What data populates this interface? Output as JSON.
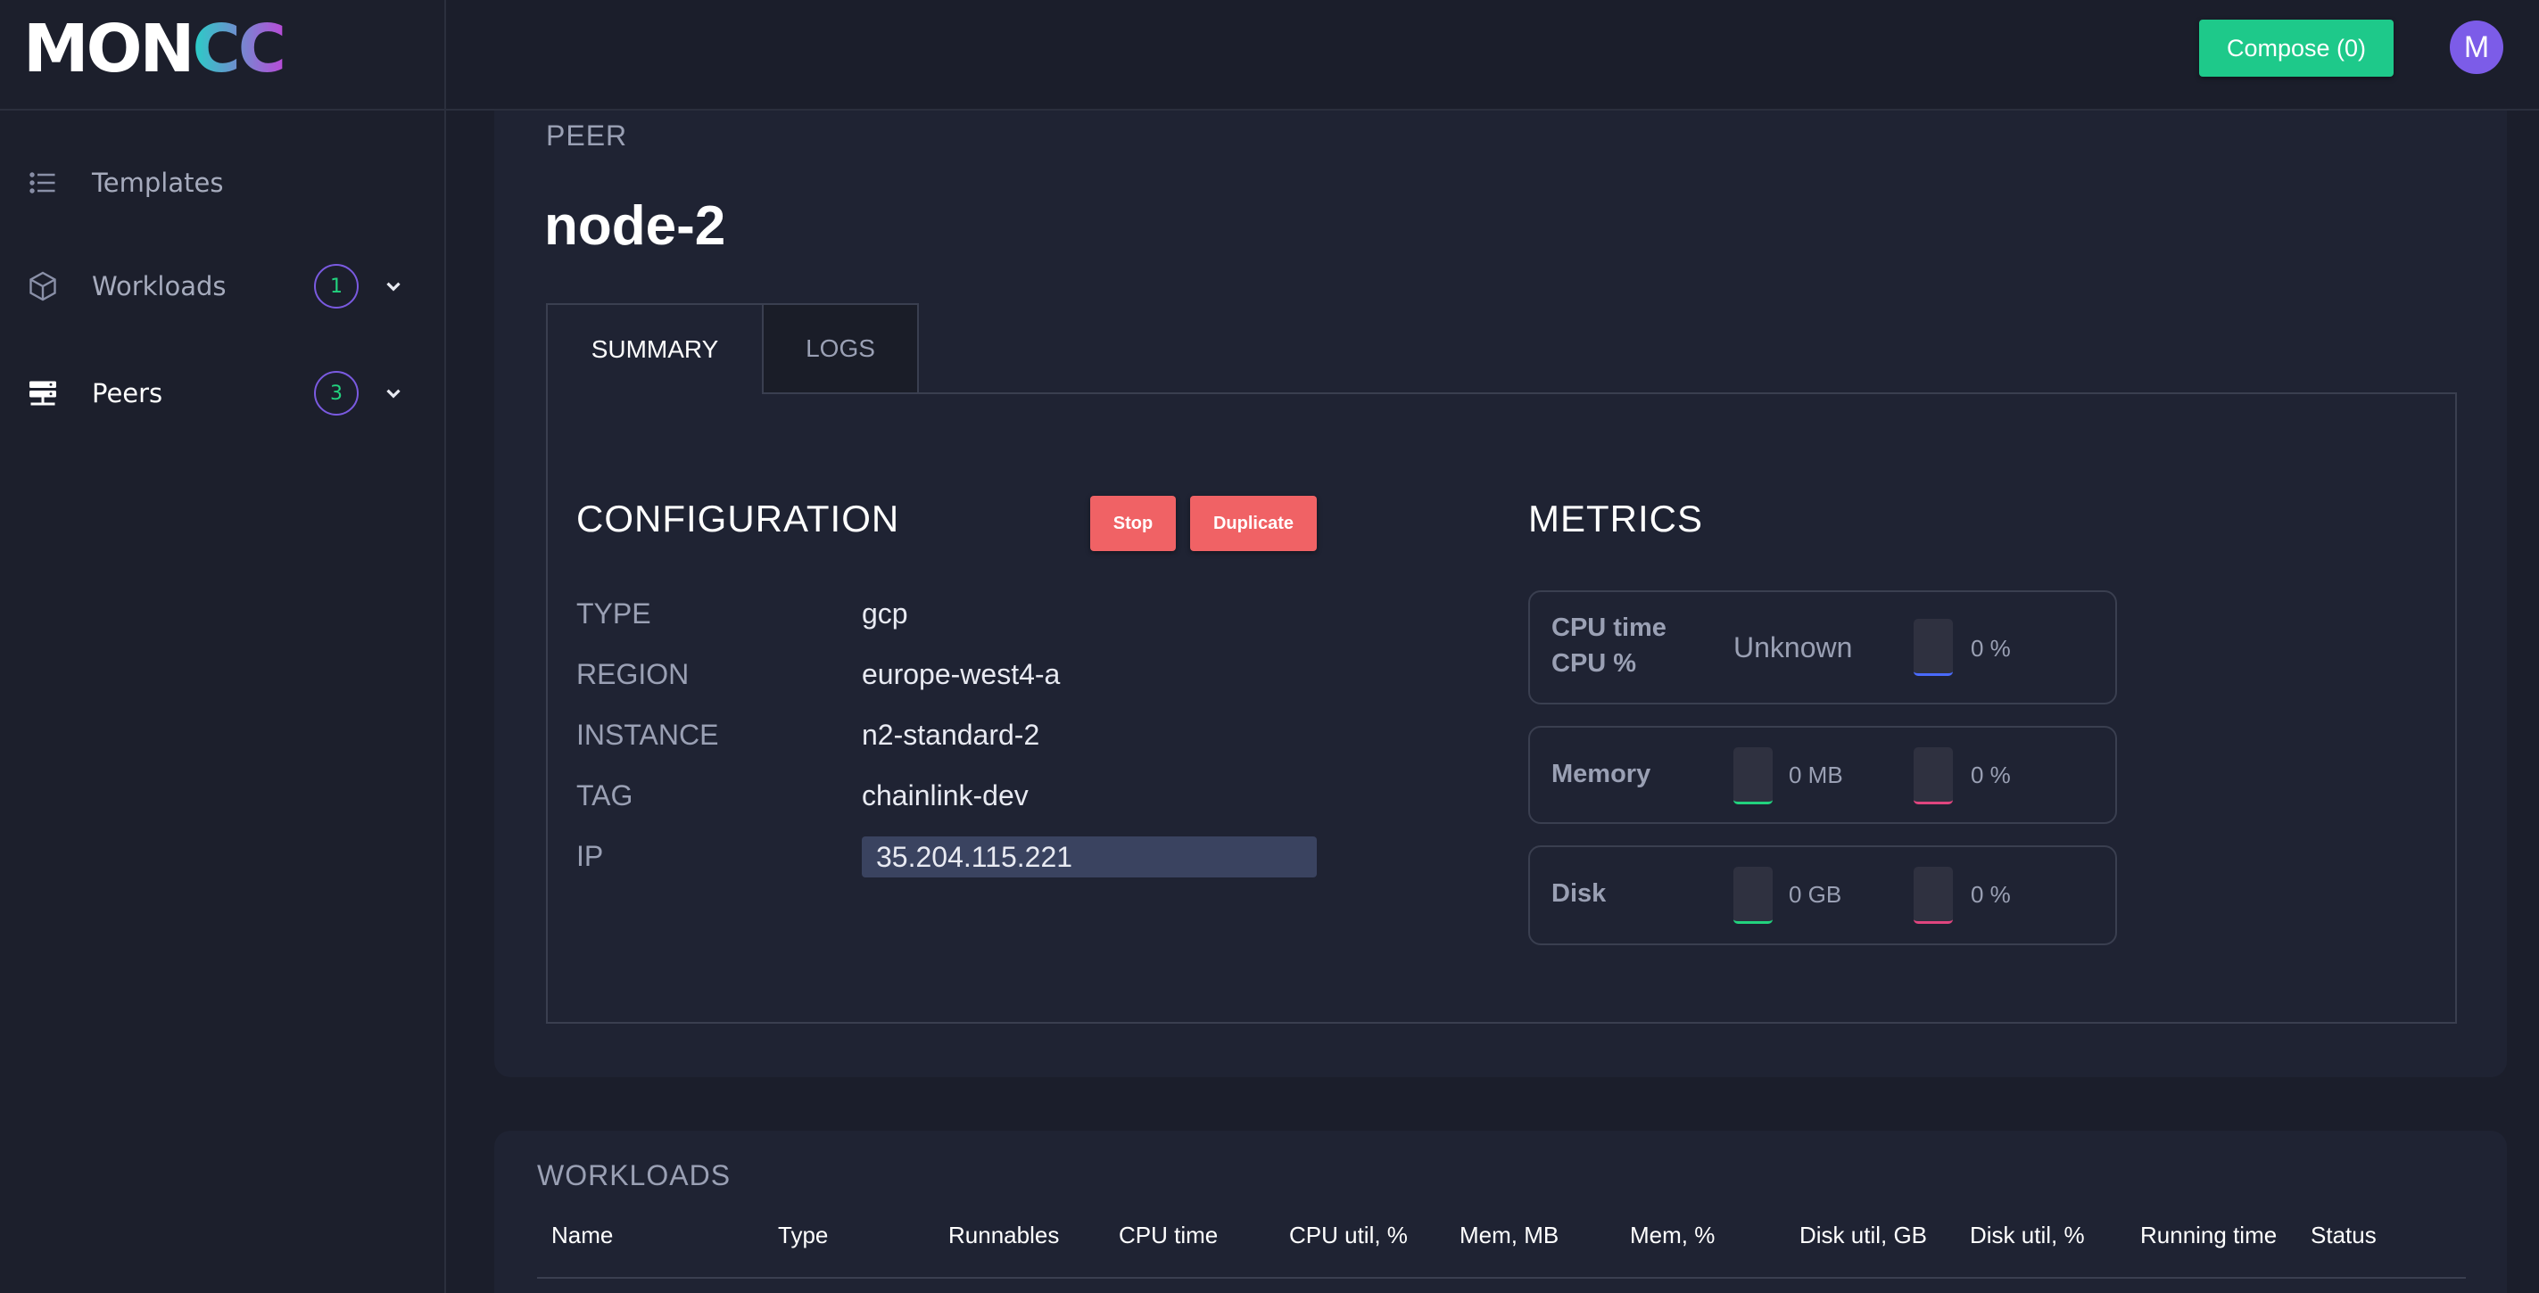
{
  "app": {
    "logo_text_main": "MON",
    "logo_text_accent": "CC"
  },
  "sidebar": {
    "items": [
      {
        "label": "Templates",
        "icon": "list-icon"
      },
      {
        "label": "Workloads",
        "icon": "cube-icon",
        "badge": "1"
      },
      {
        "label": "Peers",
        "icon": "server-icon",
        "badge": "3",
        "active": true
      }
    ]
  },
  "topbar": {
    "compose_label": "Compose (0)",
    "avatar_initial": "M"
  },
  "peer": {
    "section_label": "PEER",
    "name": "node-2"
  },
  "tabs": [
    {
      "label": "SUMMARY",
      "active": true
    },
    {
      "label": "LOGS",
      "active": false
    }
  ],
  "configuration": {
    "title": "CONFIGURATION",
    "stop_label": "Stop",
    "duplicate_label": "Duplicate",
    "rows": [
      {
        "key": "TYPE",
        "value": "gcp"
      },
      {
        "key": "REGION",
        "value": "europe-west4-a"
      },
      {
        "key": "INSTANCE",
        "value": "n2-standard-2"
      },
      {
        "key": "TAG",
        "value": "chainlink-dev"
      },
      {
        "key": "IP",
        "value": "35.204.115.221"
      }
    ]
  },
  "metrics": {
    "title": "METRICS",
    "cpu": {
      "label_time": "CPU time",
      "label_pct": "CPU %",
      "time_value": "Unknown",
      "pct_value": "0 %"
    },
    "memory": {
      "label": "Memory",
      "amount": "0 MB",
      "pct": "0 %"
    },
    "disk": {
      "label": "Disk",
      "amount": "0 GB",
      "pct": "0 %"
    }
  },
  "workloads": {
    "title": "WORKLOADS",
    "columns": [
      "Name",
      "Type",
      "Runnables",
      "CPU time",
      "CPU util, %",
      "Mem, MB",
      "Mem, %",
      "Disk util, GB",
      "Disk util, %",
      "Running time",
      "Status"
    ]
  },
  "colors": {
    "accent_green": "#1ec98a",
    "danger": "#f06265",
    "badge_border": "#7a5ae0",
    "background": "#1b1e2b"
  }
}
